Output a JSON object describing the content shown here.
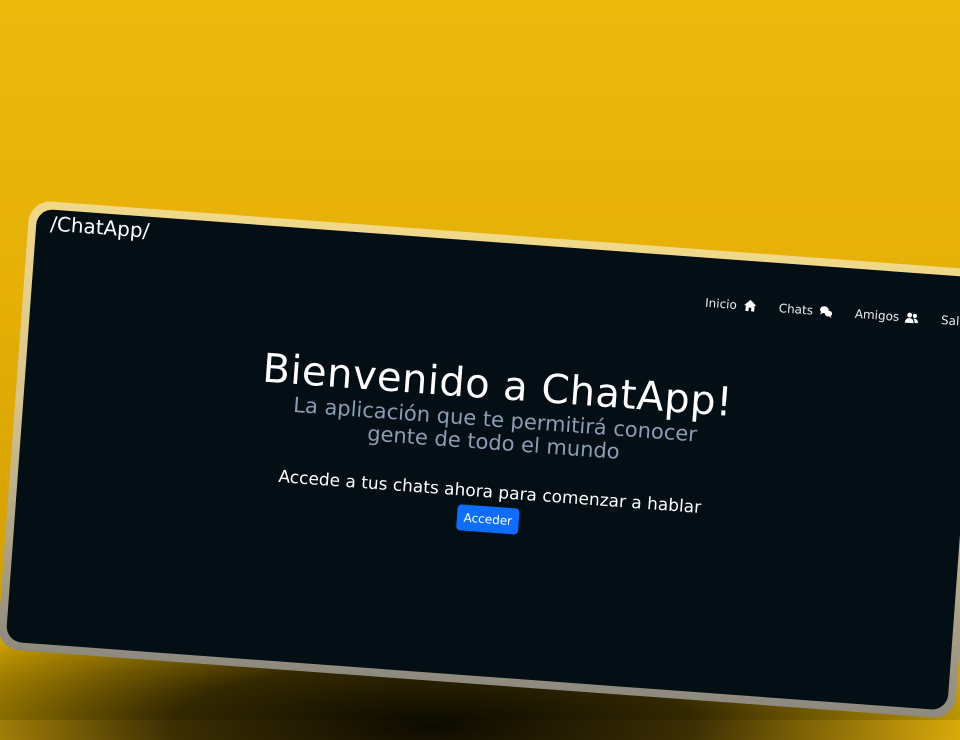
{
  "app": {
    "brand": "/ChatApp/"
  },
  "nav": {
    "items": [
      {
        "label": "Inicio",
        "icon": "home-icon"
      },
      {
        "label": "Chats",
        "icon": "chat-bubbles-icon"
      },
      {
        "label": "Amigos",
        "icon": "users-icon"
      },
      {
        "label": "Salir",
        "icon": ""
      }
    ]
  },
  "hero": {
    "title": "Bienvenido a ChatApp!",
    "subtitle": "La aplicación que te permitirá conocer gente de todo el mundo",
    "cta_text": "Accede a tus chats ahora para comenzar a hablar",
    "cta_button": "Acceder"
  },
  "colors": {
    "background": "#e6b007",
    "screen": "#040f15",
    "accent": "#0d6efd",
    "subtitle": "#8a9db3"
  }
}
